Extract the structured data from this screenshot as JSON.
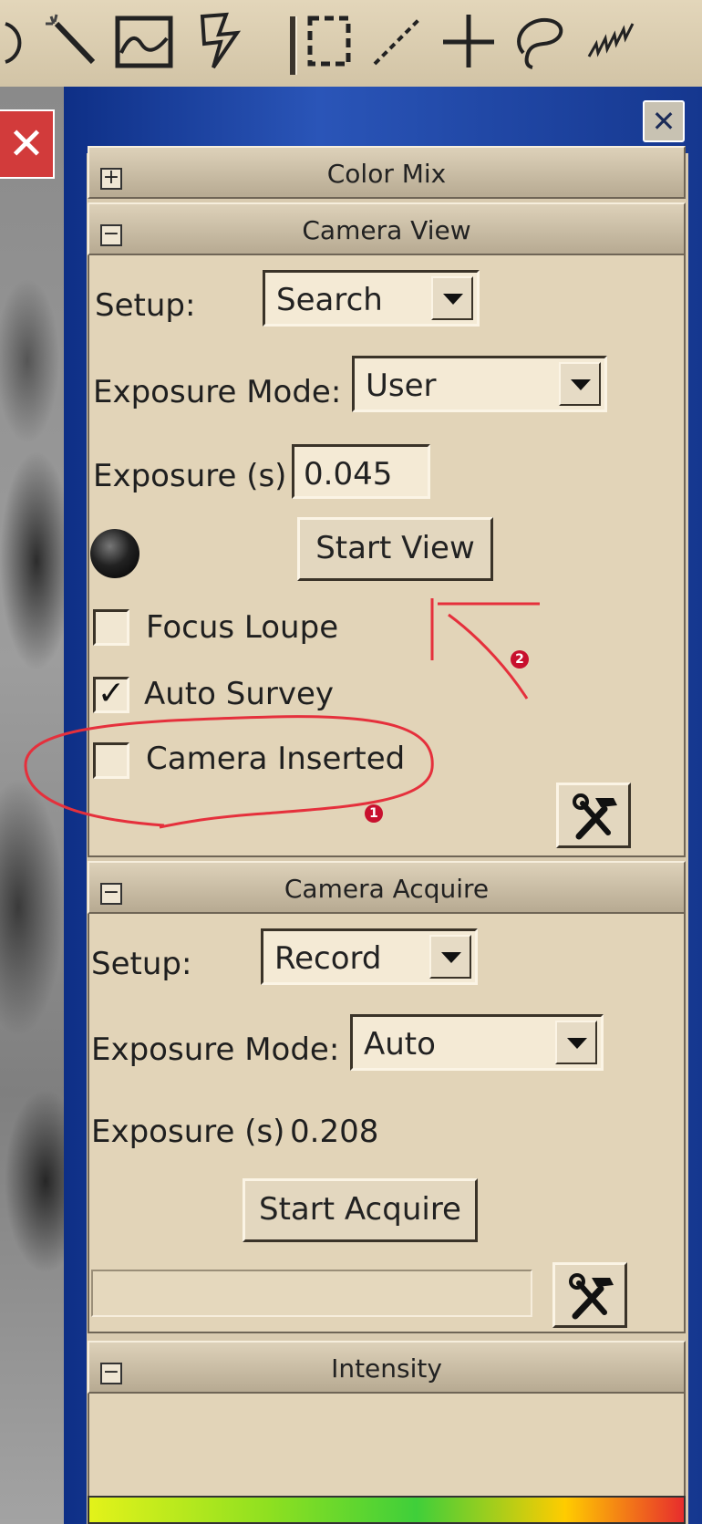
{
  "colors": {
    "panel_bg": "#e2d4b8",
    "dock_blue": "#1a3f99",
    "annotation_red": "#e5303c",
    "badge_red": "#c8102e"
  },
  "toolbar": {
    "tools": [
      "circle-select-icon",
      "magic-wand-icon",
      "line-profile-icon",
      "lightning-icon",
      "rect-select-icon",
      "line-icon",
      "crosshair-icon",
      "lasso-icon",
      "freehand-icon"
    ]
  },
  "color_mix": {
    "title": "Color Mix",
    "toggle": "+"
  },
  "camera_view": {
    "title": "Camera View",
    "toggle": "−",
    "setup_label": "Setup:",
    "setup_value": "Search",
    "exposure_mode_label": "Exposure Mode:",
    "exposure_mode_value": "User",
    "exposure_label": "Exposure (s)",
    "exposure_value": "0.045",
    "start_view_label": "Start View",
    "focus_loupe_label": "Focus Loupe",
    "focus_loupe_checked": false,
    "auto_survey_label": "Auto Survey",
    "auto_survey_checked": true,
    "camera_inserted_label": "Camera Inserted",
    "camera_inserted_checked": false
  },
  "camera_acquire": {
    "title": "Camera Acquire",
    "toggle": "−",
    "setup_label": "Setup:",
    "setup_value": "Record",
    "exposure_mode_label": "Exposure Mode:",
    "exposure_mode_value": "Auto",
    "exposure_label": "Exposure (s)",
    "exposure_value": "0.208",
    "start_acquire_label": "Start Acquire"
  },
  "intensity": {
    "title": "Intensity",
    "toggle": "−"
  },
  "annotations": {
    "badge_1": "1",
    "badge_2": "2"
  }
}
